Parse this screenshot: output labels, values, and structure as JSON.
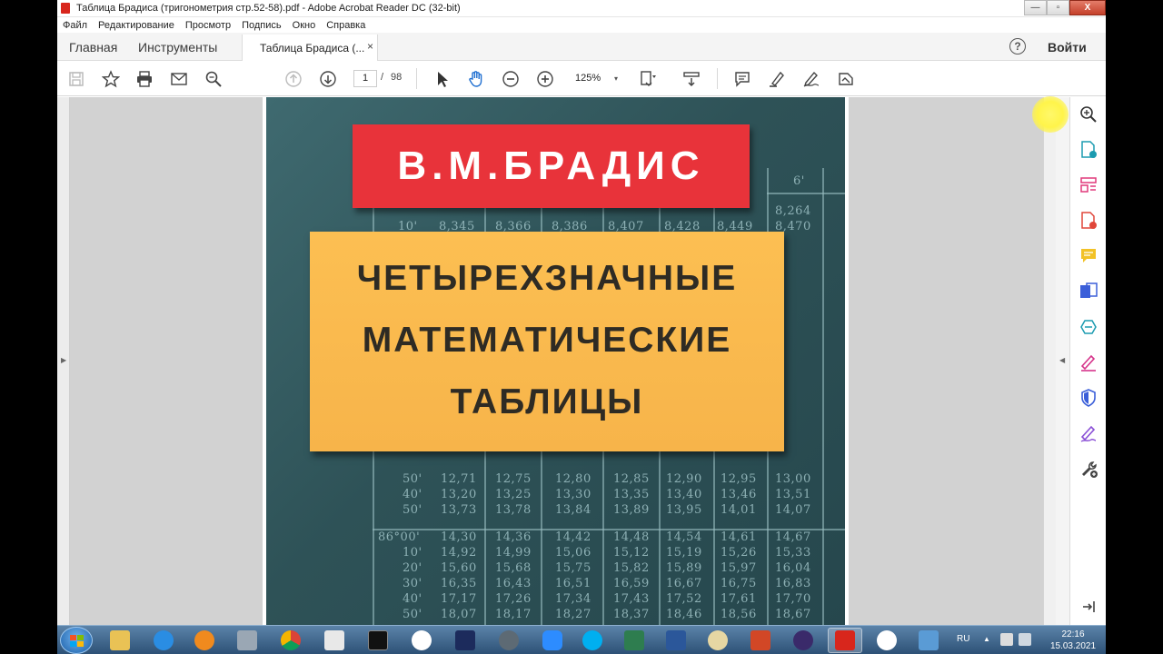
{
  "window": {
    "title": "Таблица Брадиса (тригонометрия стр.52-58).pdf - Adobe Acrobat Reader DC (32-bit)",
    "min": "—",
    "max": "▫",
    "close": "X"
  },
  "menu": [
    "Файл",
    "Редактирование",
    "Просмотр",
    "Подпись",
    "Окно",
    "Справка"
  ],
  "tabs": {
    "home": "Главная",
    "tools": "Инструменты",
    "document": "Таблица Брадиса (...",
    "close": "×"
  },
  "header": {
    "help": "?",
    "signin": "Войти"
  },
  "toolbar": {
    "current_page": "1",
    "page_separator": "/",
    "total_pages": "98",
    "zoom": "125%",
    "zoom_caret": "▾"
  },
  "cover": {
    "author": "В.М.БРАДИС",
    "title_lines": [
      "ЧЕТЫРЕХЗНАЧНЫЕ",
      "МАТЕМАТИЧЕСКИЕ",
      "ТАБЛИЦЫ"
    ],
    "bg_rows": [
      {
        "label": "50'",
        "vals": [
          "12,71",
          "12,75",
          "12,80",
          "12,85",
          "12,90",
          "12,95",
          "13,00"
        ]
      },
      {
        "label": "40'",
        "vals": [
          "13,20",
          "13,25",
          "13,30",
          "13,35",
          "13,40",
          "13,46",
          "13,51"
        ]
      },
      {
        "label": "50'",
        "vals": [
          "13,73",
          "13,78",
          "13,84",
          "13,89",
          "13,95",
          "14,01",
          "14,07"
        ]
      },
      {
        "label": "86°00'",
        "vals": [
          "14,30",
          "14,36",
          "14,42",
          "14,48",
          "14,54",
          "14,61",
          "14,67"
        ]
      },
      {
        "label": "10'",
        "vals": [
          "14,92",
          "14,99",
          "15,06",
          "15,12",
          "15,19",
          "15,26",
          "15,33"
        ]
      },
      {
        "label": "20'",
        "vals": [
          "15,60",
          "15,68",
          "15,75",
          "15,82",
          "15,89",
          "15,97",
          "16,04"
        ]
      },
      {
        "label": "30'",
        "vals": [
          "16,35",
          "16,43",
          "16,51",
          "16,59",
          "16,67",
          "16,75",
          "16,83"
        ]
      },
      {
        "label": "40'",
        "vals": [
          "17,17",
          "17,26",
          "17,34",
          "17,43",
          "17,52",
          "17,61",
          "17,70"
        ]
      },
      {
        "label": "50'",
        "vals": [
          "18,07",
          "18,17",
          "18,27",
          "18,37",
          "18,46",
          "18,56",
          "18,67"
        ]
      }
    ],
    "top_right_vals": [
      "6'",
      "8,264",
      "8,470"
    ],
    "top_left_row": [
      "10'",
      "8,345",
      "8,366",
      "8,386",
      "8,407",
      "8,428",
      "8,449"
    ]
  },
  "taskbar": {
    "lang": "RU",
    "tray_up": "▲",
    "time": "22:16",
    "date": "15.03.2021"
  },
  "colors": {
    "cover_red": "#e8333a",
    "cover_yellow": "#f7b44a",
    "cover_bg": "#2e5257",
    "acrobat_red": "#d8261c"
  }
}
